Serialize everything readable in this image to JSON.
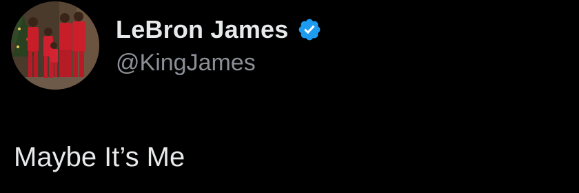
{
  "author": {
    "display_name": "LeBron James",
    "handle": "@KingJames",
    "verified": true,
    "verified_badge_icon": "verified-badge-icon",
    "badge_color": "#1d9bf0",
    "avatar": "profile-photo"
  },
  "tweet": {
    "text": "Maybe It’s Me"
  },
  "theme": {
    "background": "#000000",
    "text_color": "#e7e9ea",
    "secondary_text_color": "#8b9097"
  }
}
